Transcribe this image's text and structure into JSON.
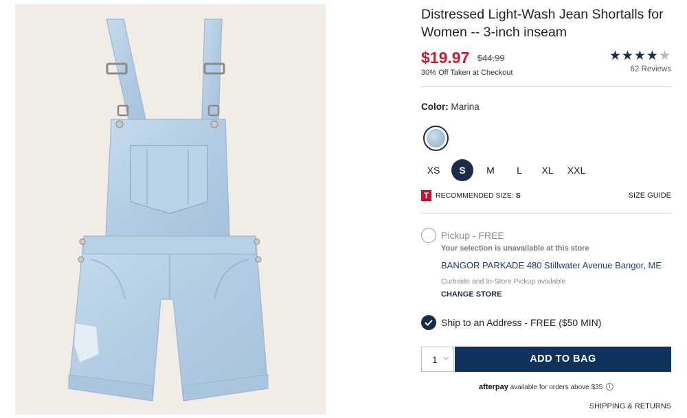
{
  "product": {
    "title": "Distressed Light-Wash Jean Shortalls for Women -- 3-inch inseam",
    "sale_price": "$19.97",
    "original_price": "$44.99",
    "promo_note": "30% Off Taken at Checkout",
    "rating": {
      "stars_text": "★★★★",
      "half_star": "★",
      "value": 4.5,
      "max": 5,
      "reviews": "62 Reviews"
    },
    "image_alt": "Light-wash denim shortalls with adjustable straps and distressed leg"
  },
  "color": {
    "label": "Color:",
    "value": "Marina"
  },
  "sizes": {
    "options": [
      "XS",
      "S",
      "M",
      "L",
      "XL",
      "XXL"
    ],
    "selected": "S"
  },
  "recommendation": {
    "logo": "T",
    "text": "Recommended size:",
    "size": "S",
    "size_guide": "SIZE GUIDE"
  },
  "pickup": {
    "label": "Pickup - FREE",
    "unavailable": "Your selection is unavailable at this store",
    "store": "BANGOR PARKADE 480 Stillwater Avenue Bangor, ME",
    "curbside": "Curbside and In-Store Pickup available",
    "change_store": "CHANGE STORE"
  },
  "shipping": {
    "label": "Ship to an Address - FREE ($50 MIN)"
  },
  "cart": {
    "quantity": "1",
    "add_label": "ADD TO BAG"
  },
  "afterpay": {
    "brand": "afterpay",
    "text": "available for orders above $35",
    "info_icon": "i"
  },
  "footer": {
    "shipping_returns": "SHIPPING & RETURNS"
  },
  "colors": {
    "navy": "#1a2c48",
    "sale_red": "#cc1d2e",
    "button_navy": "#10335e",
    "denim": "#b4cde3"
  }
}
